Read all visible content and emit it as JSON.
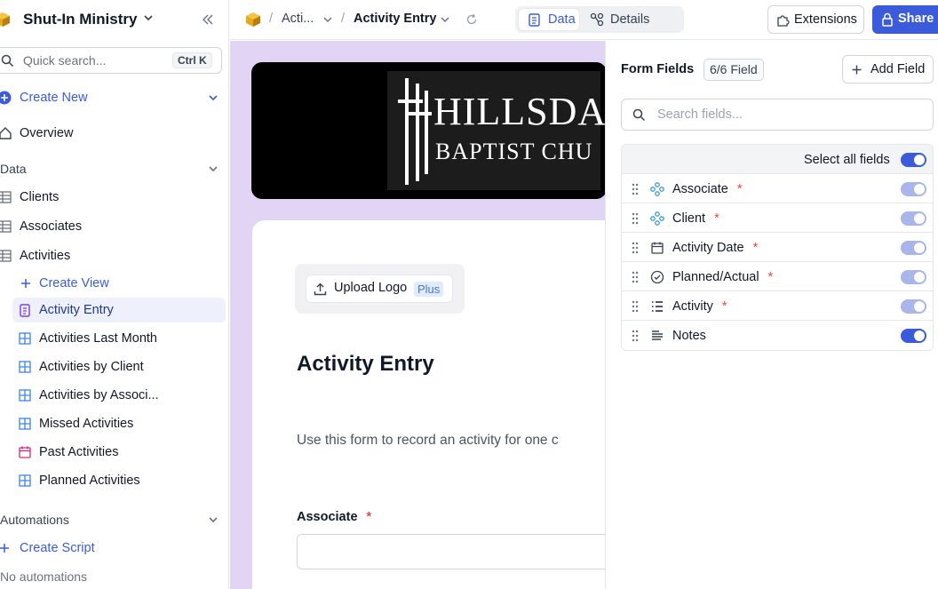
{
  "workspace": {
    "name": "Shut-In Ministry"
  },
  "search": {
    "placeholder": "Quick search...",
    "shortcut": "Ctrl K"
  },
  "sidebar": {
    "create_new": "Create New",
    "overview": "Overview",
    "data_section": "Data",
    "tables": [
      "Clients",
      "Associates",
      "Activities"
    ],
    "create_view": "Create View",
    "views": [
      {
        "label": "Activity Entry",
        "icon": "form-icon",
        "active": true
      },
      {
        "label": "Activities Last Month",
        "icon": "grid-view-icon"
      },
      {
        "label": "Activities by Client",
        "icon": "grid-view-icon"
      },
      {
        "label": "Activities by Associ...",
        "icon": "grid-view-icon"
      },
      {
        "label": "Missed Activities",
        "icon": "grid-view-icon"
      },
      {
        "label": "Past Activities",
        "icon": "calendar-view-icon"
      },
      {
        "label": "Planned Activities",
        "icon": "grid-view-icon"
      }
    ],
    "automations_section": "Automations",
    "create_script": "Create Script",
    "no_automations": "No automations"
  },
  "topbar": {
    "crumb_table": "Acti...",
    "crumb_view": "Activity Entry",
    "tab_data": "Data",
    "tab_details": "Details",
    "extensions": "Extensions",
    "share": "Share"
  },
  "form": {
    "banner_text_line1": "HILLSDA",
    "banner_text_line2": "BAPTIST CHU",
    "upload_logo": "Upload Logo",
    "plus_badge": "Plus",
    "title": "Activity Entry",
    "description": "Use this form to record an activity for one c",
    "first_field_label": "Associate",
    "required_mark": "*"
  },
  "panel": {
    "title": "Form Fields",
    "count": "6/6 Field",
    "add_field": "Add Field",
    "search_placeholder": "Search fields...",
    "select_all": "Select all fields",
    "fields": [
      {
        "name": "Associate",
        "required": true,
        "icon": "link-icon",
        "state": "dim"
      },
      {
        "name": "Client",
        "required": true,
        "icon": "link-icon",
        "state": "dim"
      },
      {
        "name": "Activity Date",
        "required": true,
        "icon": "calendar-icon",
        "state": "dim"
      },
      {
        "name": "Planned/Actual",
        "required": true,
        "icon": "check-circle-icon",
        "state": "dim"
      },
      {
        "name": "Activity",
        "required": true,
        "icon": "list-icon",
        "state": "dim"
      },
      {
        "name": "Notes",
        "required": false,
        "icon": "long-text-icon",
        "state": "on"
      }
    ]
  },
  "colors": {
    "accent": "#3b5bdb",
    "canvas_bg": "#e2d4f4",
    "required": "#ef4444"
  }
}
